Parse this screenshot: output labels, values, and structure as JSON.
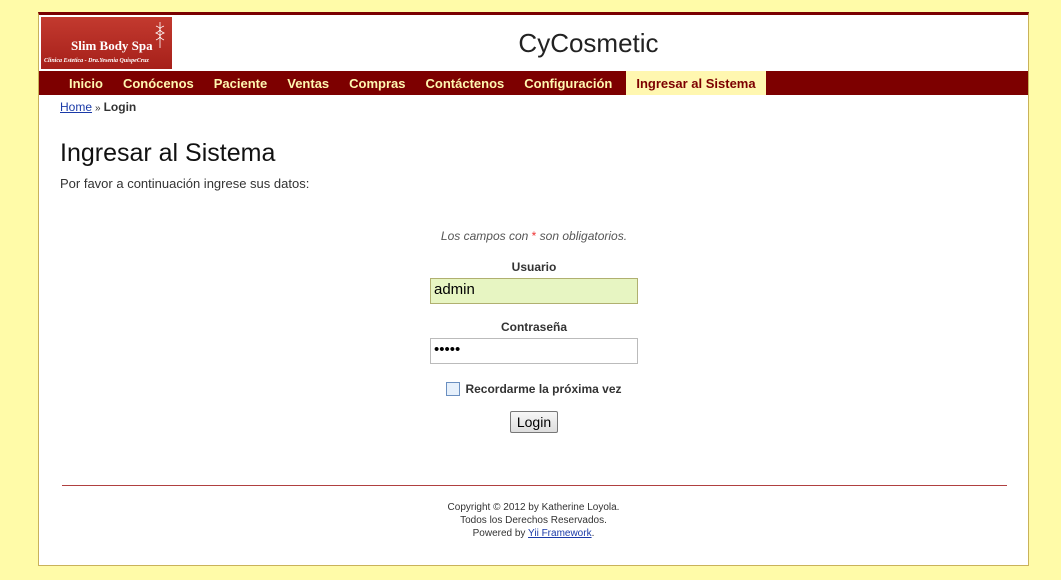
{
  "logo": {
    "main": "Slim Body Spa",
    "sub": "Clinica Estetica - Dra.Yesenia QuispeCruz"
  },
  "site": {
    "title": "CyCosmetic"
  },
  "nav": {
    "items": [
      "Inicio",
      "Conócenos",
      "Paciente",
      "Ventas",
      "Compras",
      "Contáctenos",
      "Configuración",
      "Ingresar al Sistema"
    ],
    "active": "Ingresar al Sistema"
  },
  "breadcrumb": {
    "home": "Home",
    "separator": "»",
    "current": "Login"
  },
  "page": {
    "heading": "Ingresar al Sistema",
    "intro": "Por favor a continuación ingrese sus datos:"
  },
  "form": {
    "note_prefix": "Los campos con",
    "note_star": "*",
    "note_suffix": "son obligatorios.",
    "username_label": "Usuario",
    "username_value": "admin",
    "password_label": "Contraseña",
    "password_value": "•••••",
    "remember_label": "Recordarme la próxima vez",
    "remember_checked": false,
    "submit_label": "Login"
  },
  "footer": {
    "line1": "Copyright © 2012 by Katherine Loyola.",
    "line2": "Todos los Derechos Reservados.",
    "powered_prefix": "Powered by",
    "powered_link": "Yii Framework",
    "powered_suffix": "."
  },
  "colors": {
    "nav_bg": "#7d0000",
    "nav_text": "#fff7b0",
    "body_bg": "#fffba8",
    "logo_bg": "#b02a22"
  }
}
